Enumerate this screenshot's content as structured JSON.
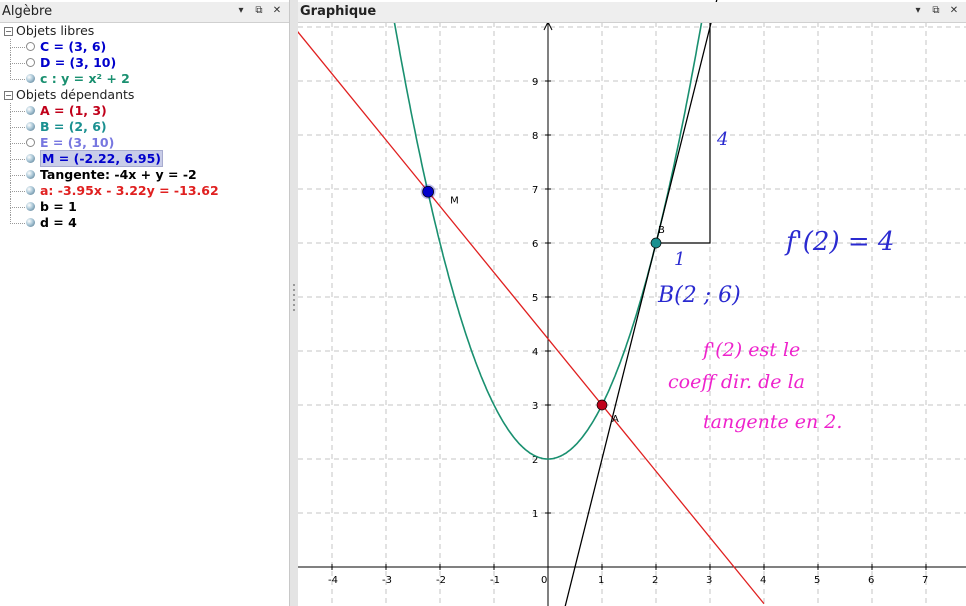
{
  "algebra": {
    "title": "Algèbre",
    "free_group": "Objets libres",
    "free_items": [
      {
        "text": "C = (3, 6)",
        "color": "#0000cc",
        "visible": false
      },
      {
        "text": "D = (3, 10)",
        "color": "#0000cc",
        "visible": false
      },
      {
        "text": "c : y = x² + 2",
        "color": "#1a9070",
        "visible": true
      }
    ],
    "dependent_group": "Objets dépendants",
    "dependent_items": [
      {
        "text": "A = (1, 3)",
        "color": "#c0001a",
        "visible": true
      },
      {
        "text": "B = (2, 6)",
        "color": "#1a9090",
        "visible": true
      },
      {
        "text": "E = (3, 10)",
        "color": "#7777e0",
        "visible": false
      },
      {
        "text": "M = (-2.22, 6.95)",
        "color": "#0000cc",
        "visible": true,
        "selected": true
      },
      {
        "text": "Tangente: -4x + y = -2",
        "color": "#000000",
        "visible": true
      },
      {
        "text": "a: -3.95x - 3.22y = -13.62",
        "color": "#e02020",
        "visible": true
      },
      {
        "text": "b = 1",
        "color": "#000000",
        "visible": true
      },
      {
        "text": "d = 4",
        "color": "#000000",
        "visible": true
      }
    ]
  },
  "graphics": {
    "title": "Graphique",
    "x_ticks": [
      "-4",
      "-3",
      "-2",
      "-1",
      "0",
      "1",
      "2",
      "3",
      "4",
      "5",
      "6",
      "7"
    ],
    "y_ticks": [
      "1",
      "2",
      "3",
      "4",
      "5",
      "6",
      "7",
      "8",
      "9"
    ],
    "point_labels": {
      "M": "M",
      "A": "A",
      "B": "B"
    },
    "slope_labels": {
      "run": "1",
      "rise": "4"
    },
    "annotations": {
      "fprime": "f'(2) = 4",
      "bpoint": "B(2 ; 6)",
      "note_line1": "f'(2) est le",
      "note_line2": "coeff dir. de la",
      "note_line3": "tangente en 2."
    },
    "colors": {
      "parabola": "#1a9070",
      "secant": "#e02020",
      "tangent": "#000000",
      "point_M": "#0000cc",
      "point_A": "#c0001a",
      "point_B": "#1a9090",
      "ink_blue": "#2a2ad0",
      "ink_magenta": "#ee22cc"
    }
  },
  "header_buttons": {
    "menu": "▾",
    "detach": "⧉",
    "close": "✕"
  }
}
